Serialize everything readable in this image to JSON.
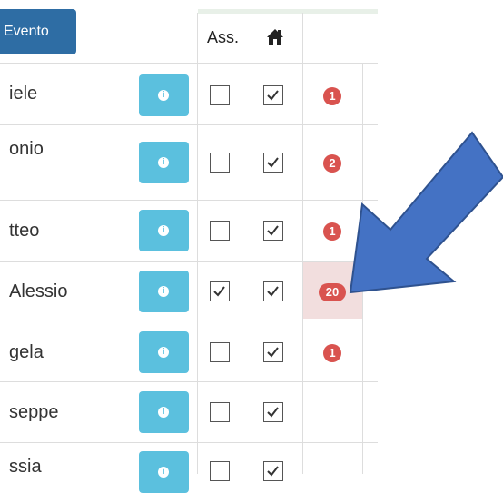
{
  "toolbar": {
    "evento_label": "Evento"
  },
  "header": {
    "ass_label": "Ass.",
    "home_icon": "home-icon"
  },
  "rows": [
    {
      "name": "iele",
      "ass": false,
      "home": true,
      "badge": "1"
    },
    {
      "name": "onio",
      "ass": false,
      "home": true,
      "badge": "2"
    },
    {
      "name": "tteo",
      "ass": false,
      "home": true,
      "badge": "1"
    },
    {
      "name": "Alessio",
      "ass": true,
      "home": true,
      "badge": "20"
    },
    {
      "name": "gela",
      "ass": false,
      "home": true,
      "badge": "1"
    },
    {
      "name": "seppe",
      "ass": false,
      "home": true,
      "badge": ""
    },
    {
      "name": "ssia",
      "ass": false,
      "home": true,
      "badge": ""
    }
  ],
  "annotation": {
    "arrow_color": "#4472c4",
    "highlight_color": "#f2dede"
  }
}
